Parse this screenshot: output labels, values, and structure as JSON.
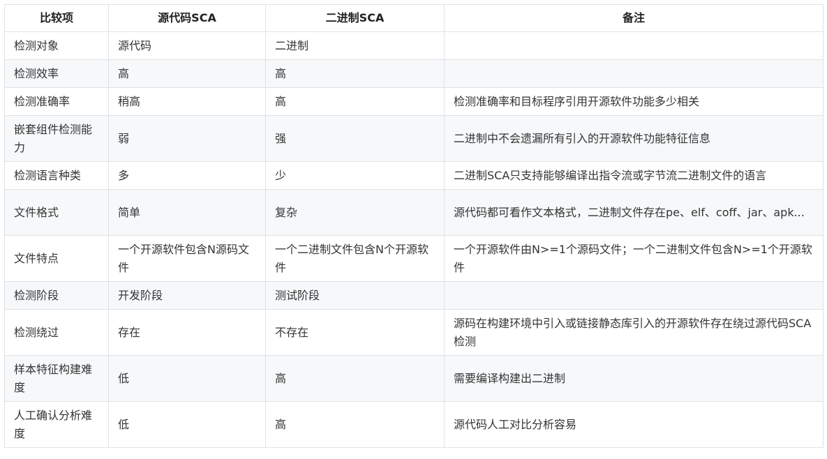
{
  "table": {
    "headers": [
      "比较项",
      "源代码SCA",
      "二进制SCA",
      "备注"
    ],
    "rows": [
      [
        "检测对象",
        "源代码",
        "二进制",
        ""
      ],
      [
        "检测效率",
        "高",
        "高",
        ""
      ],
      [
        "检测准确率",
        "稍高",
        "高",
        "检测准确率和目标程序引用开源软件功能多少相关"
      ],
      [
        "嵌套组件检测能力",
        "弱",
        "强",
        "二进制中不会遗漏所有引入的开源软件功能特征信息"
      ],
      [
        "检测语言种类",
        "多",
        "少",
        "二进制SCA只支持能够编译出指令流或字节流二进制文件的语言"
      ],
      [
        "文件格式",
        "简单",
        "复杂",
        "源代码都可看作文本格式，二进制文件存在pe、elf、coff、jar、apk..."
      ],
      [
        "文件特点",
        "一个开源软件包含N源码文件",
        "一个二进制文件包含N个开源软件",
        "一个开源软件由N>=1个源码文件；一个二进制文件包含N>=1个开源软件"
      ],
      [
        "检测阶段",
        "开发阶段",
        "测试阶段",
        ""
      ],
      [
        "检测绕过",
        "存在",
        "不存在",
        "源码在构建环境中引入或链接静态库引入的开源软件存在绕过源代码SCA检测"
      ],
      [
        "样本特征构建难度",
        "低",
        "高",
        "需要编译构建出二进制"
      ],
      [
        "人工确认分析难度",
        "低",
        "高",
        "源代码人工对比分析容易"
      ]
    ]
  }
}
